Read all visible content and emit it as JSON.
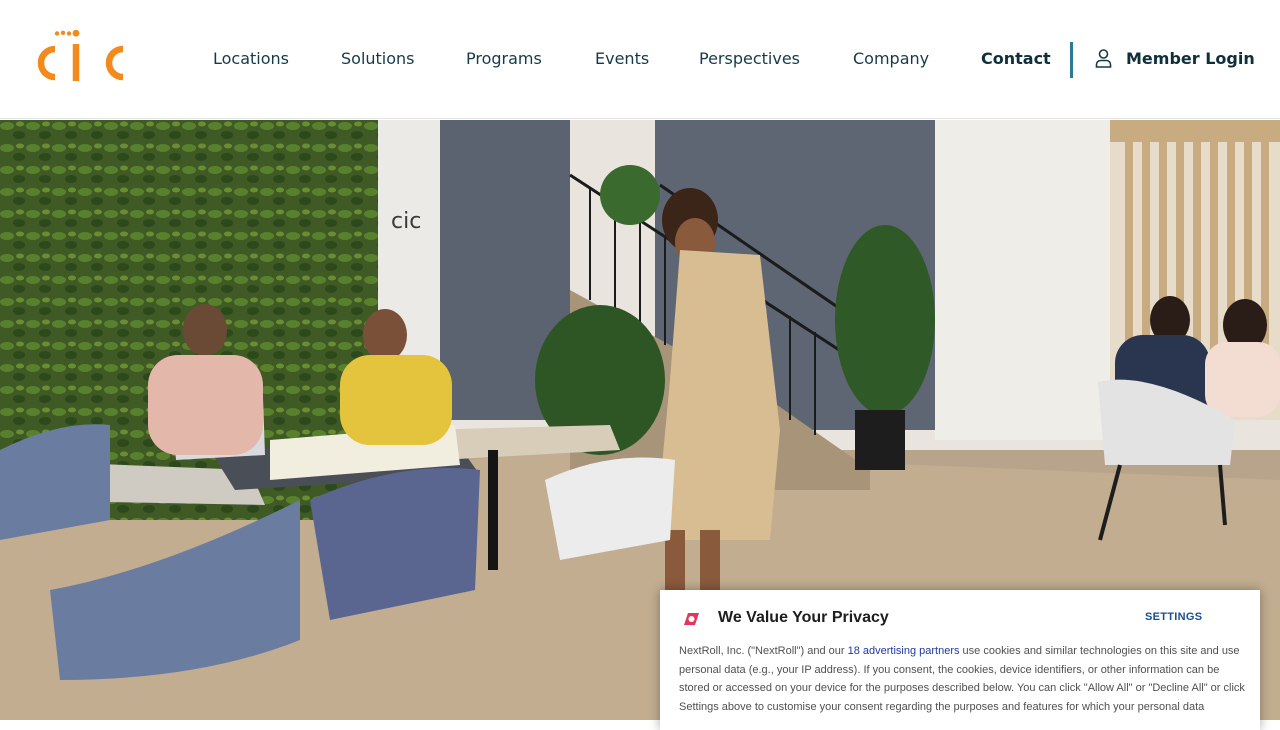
{
  "brand": {
    "logo_text": "cic",
    "logo_color": "#f28a1e"
  },
  "nav": {
    "items": [
      {
        "label": "Locations"
      },
      {
        "label": "Solutions"
      },
      {
        "label": "Programs"
      },
      {
        "label": "Events"
      },
      {
        "label": "Perspectives"
      },
      {
        "label": "Company"
      },
      {
        "label": "Contact"
      }
    ],
    "login_label": "Member Login",
    "login_icon": "user-icon",
    "divider_color": "#2c7a93",
    "text_color": "#173a49"
  },
  "hero": {
    "description_icon": "hero-photo"
  },
  "cookie_banner": {
    "icon": "nextroll-icon",
    "title": "We Value Your Privacy",
    "settings_label": "SETTINGS",
    "text_before_link": "NextRoll, Inc. (\"NextRoll\") and our ",
    "link_text": "18 advertising partners",
    "text_after_link": " use cookies and similar technologies on this site and use personal data (e.g., your IP address). If you consent, the cookies, device identifiers, or other information can be stored or accessed on your device for the purposes described below. You can click \"Allow All\" or \"Decline All\" or click Settings above to customise your consent regarding the purposes and features for which your personal data",
    "accent_color": "#e3365c"
  }
}
